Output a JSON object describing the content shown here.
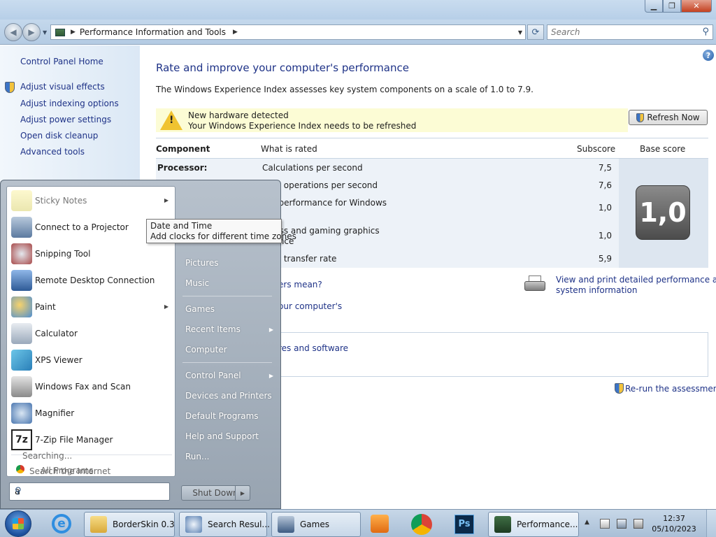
{
  "window": {
    "address_segment": "Performance Information and Tools",
    "search_placeholder": "Search"
  },
  "leftpane": {
    "home": "Control Panel Home",
    "links": [
      "Adjust visual effects",
      "Adjust indexing options",
      "Adjust power settings",
      "Open disk cleanup",
      "Advanced tools"
    ]
  },
  "main": {
    "title": "Rate and improve your computer's performance",
    "description": "The Windows Experience Index assesses key system components on a scale of 1.0 to 7.9.",
    "notice_title": "New hardware detected",
    "notice_body": "Your Windows Experience Index needs to be refreshed",
    "refresh_button": "Refresh Now",
    "table": {
      "headers": [
        "Component",
        "What is rated",
        "Subscore",
        "Base score"
      ],
      "rows": [
        {
          "component": "Processor:",
          "what": "Calculations per second",
          "sub": "7,5"
        },
        {
          "component": "",
          "what": "nory operations per second",
          "sub": "7,6"
        },
        {
          "component": "",
          "what": "top performance for Windows",
          "sub": "1,0"
        },
        {
          "component": "",
          "what": "siness and gaming graphics",
          "what2": "rmance",
          "sub": "1,0"
        },
        {
          "component": "",
          "what": "data transfer rate",
          "sub": "5,9"
        }
      ],
      "base_score": "1,0"
    },
    "link_scores": "ers mean?",
    "link_tips": "our computer's",
    "link_print": "View and print detailed performance and",
    "link_print2": "system information",
    "link_software": "res and software",
    "rerun": "Re-run the assessment"
  },
  "startmenu": {
    "programs": [
      {
        "label": "Sticky Notes",
        "arrow": true,
        "dim": true
      },
      {
        "label": "Connect to a Projector",
        "arrow": false,
        "dim": false
      },
      {
        "label": "Snipping Tool",
        "arrow": false,
        "dim": false
      },
      {
        "label": "Remote Desktop Connection",
        "arrow": false,
        "dim": false
      },
      {
        "label": "Paint",
        "arrow": true,
        "dim": false
      },
      {
        "label": "Calculator",
        "arrow": false,
        "dim": false
      },
      {
        "label": "XPS Viewer",
        "arrow": false,
        "dim": false
      },
      {
        "label": "Windows Fax and Scan",
        "arrow": false,
        "dim": false
      },
      {
        "label": "Magnifier",
        "arrow": false,
        "dim": false
      },
      {
        "label": "7-Zip File Manager",
        "arrow": false,
        "dim": false
      }
    ],
    "searching": "Searching...",
    "search_internet": "Search the Internet",
    "all_programs": "All Programs",
    "search_value": "a",
    "right_items": [
      "Pictures",
      "Music",
      "Games",
      "Recent Items",
      "Computer",
      "Control Panel",
      "Devices and Printers",
      "Default Programs",
      "Help and Support",
      "Run..."
    ],
    "shutdown": "Shut Down"
  },
  "tooltip": {
    "title": "Date and Time",
    "body": "Add clocks for different time zones"
  },
  "taskbar": {
    "buttons": [
      "BorderSkin 0.3",
      "Search Resul...",
      "Games",
      "Performance..."
    ],
    "time": "12:37",
    "date": "05/10/2023"
  }
}
